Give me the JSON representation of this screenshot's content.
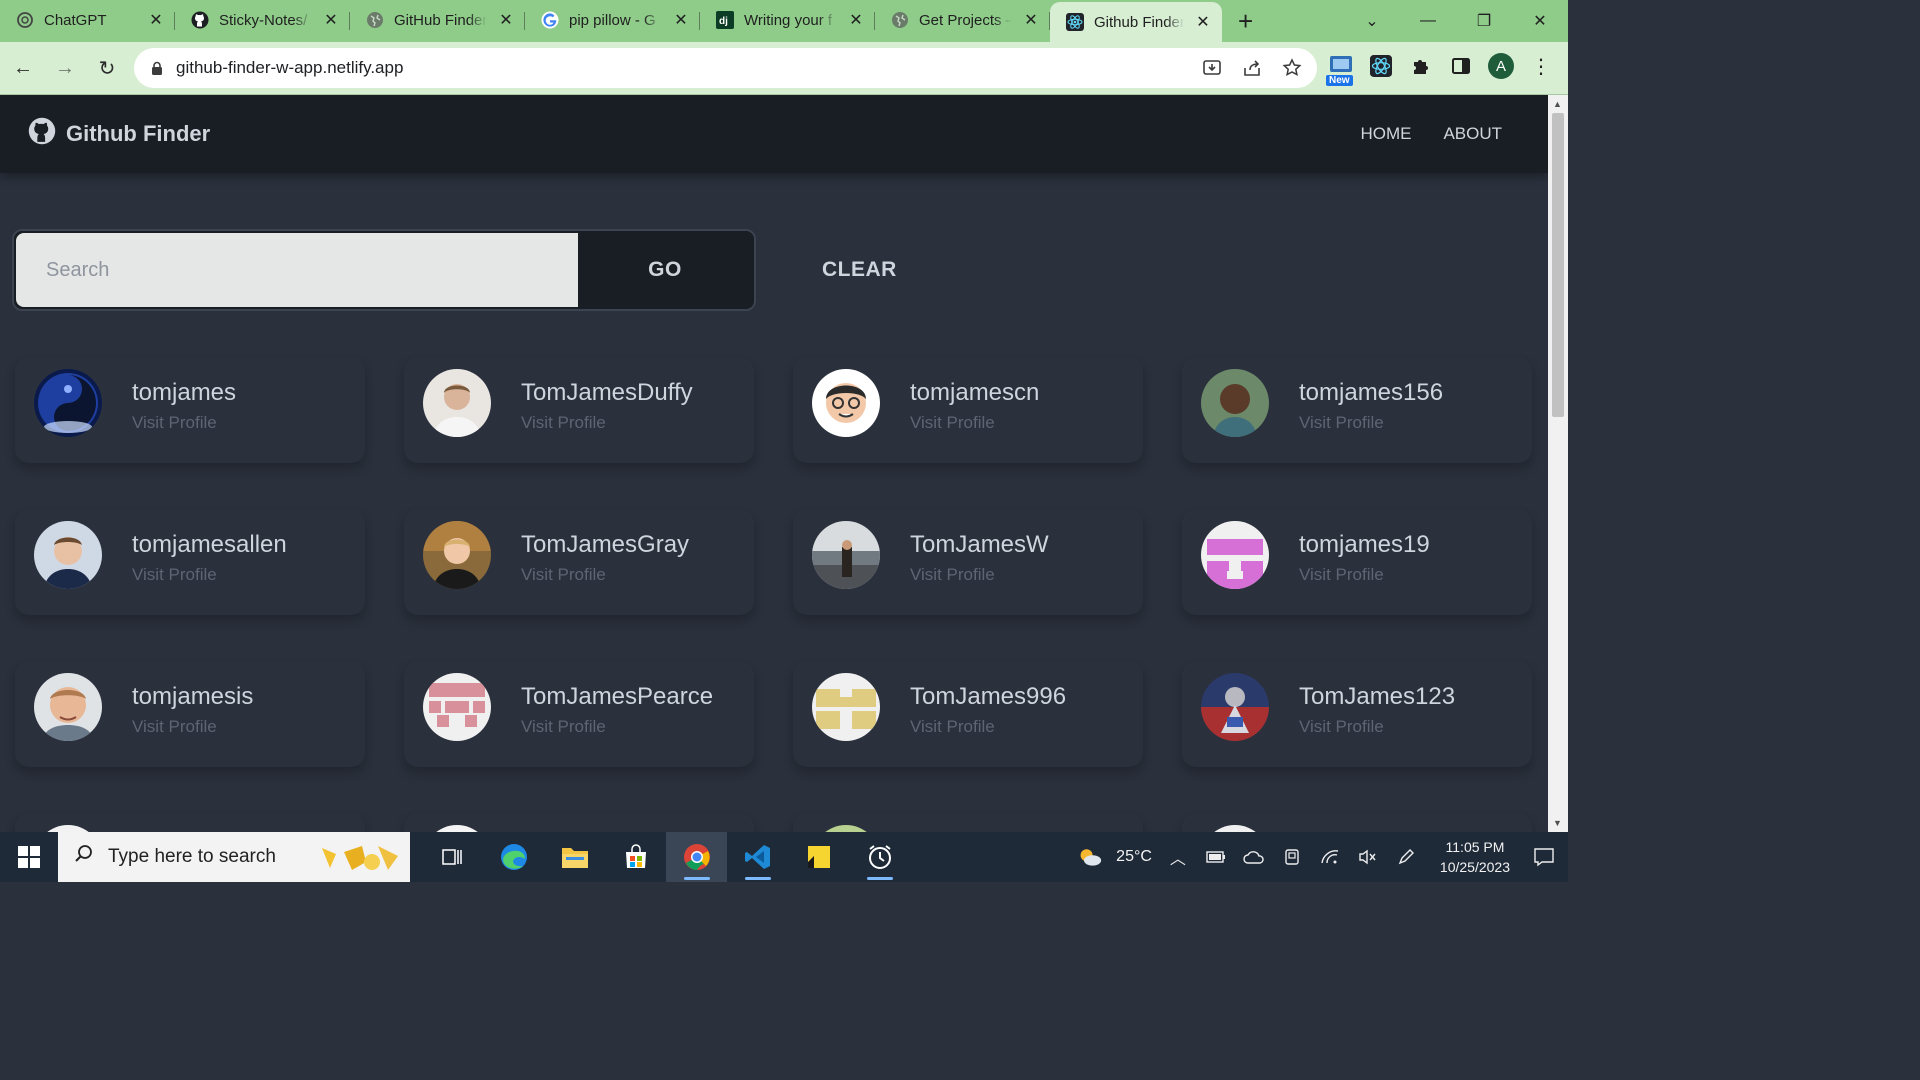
{
  "browser": {
    "tabs": [
      {
        "title": "ChatGPT",
        "icon": "chatgpt-icon",
        "active": false
      },
      {
        "title": "Sticky-Notes/",
        "icon": "github-icon",
        "active": false
      },
      {
        "title": "GitHub Finder",
        "icon": "globe-icon",
        "active": false
      },
      {
        "title": "pip pillow - G",
        "icon": "google-icon",
        "active": false
      },
      {
        "title": "Writing your f",
        "icon": "django-icon",
        "active": false
      },
      {
        "title": "Get Projects –",
        "icon": "globe-icon",
        "active": false
      },
      {
        "title": "Github Finder",
        "icon": "react-icon",
        "active": true
      }
    ],
    "url": "github-finder-w-app.netlify.app",
    "profile_initial": "A",
    "new_badge": "New"
  },
  "app": {
    "brand": "Github Finder",
    "nav": {
      "home": "HOME",
      "about": "ABOUT"
    },
    "search": {
      "placeholder": "Search",
      "value": "",
      "go_label": "GO",
      "clear_label": "CLEAR"
    },
    "visit_label": "Visit Profile",
    "users": [
      {
        "login": "tomjames",
        "avatar": "yin-yang-space"
      },
      {
        "login": "TomJamesDuffy",
        "avatar": "photo"
      },
      {
        "login": "tomjamescn",
        "avatar": "cartoon-glasses"
      },
      {
        "login": "tomjames156",
        "avatar": "photo"
      },
      {
        "login": "tomjamesallen",
        "avatar": "photo"
      },
      {
        "login": "TomJamesGray",
        "avatar": "photo"
      },
      {
        "login": "TomJamesW",
        "avatar": "photo-lake"
      },
      {
        "login": "tomjames19",
        "avatar": "identicon-pink"
      },
      {
        "login": "tomjamesis",
        "avatar": "photo"
      },
      {
        "login": "TomJamesPearce",
        "avatar": "identicon-rose"
      },
      {
        "login": "TomJames996",
        "avatar": "identicon-gold"
      },
      {
        "login": "TomJames123",
        "avatar": "knight-illustration"
      }
    ]
  },
  "taskbar": {
    "search_placeholder": "Type here to search",
    "weather": "25°C",
    "time": "11:05 PM",
    "date": "10/25/2023"
  },
  "colors": {
    "tab_strip": "#8fcc8a",
    "toolbar": "#d7eed3",
    "page_bg": "#2a303c",
    "navbar_bg": "#191e24",
    "text_primary": "#cfd4dd",
    "text_muted": "#5d6573"
  }
}
